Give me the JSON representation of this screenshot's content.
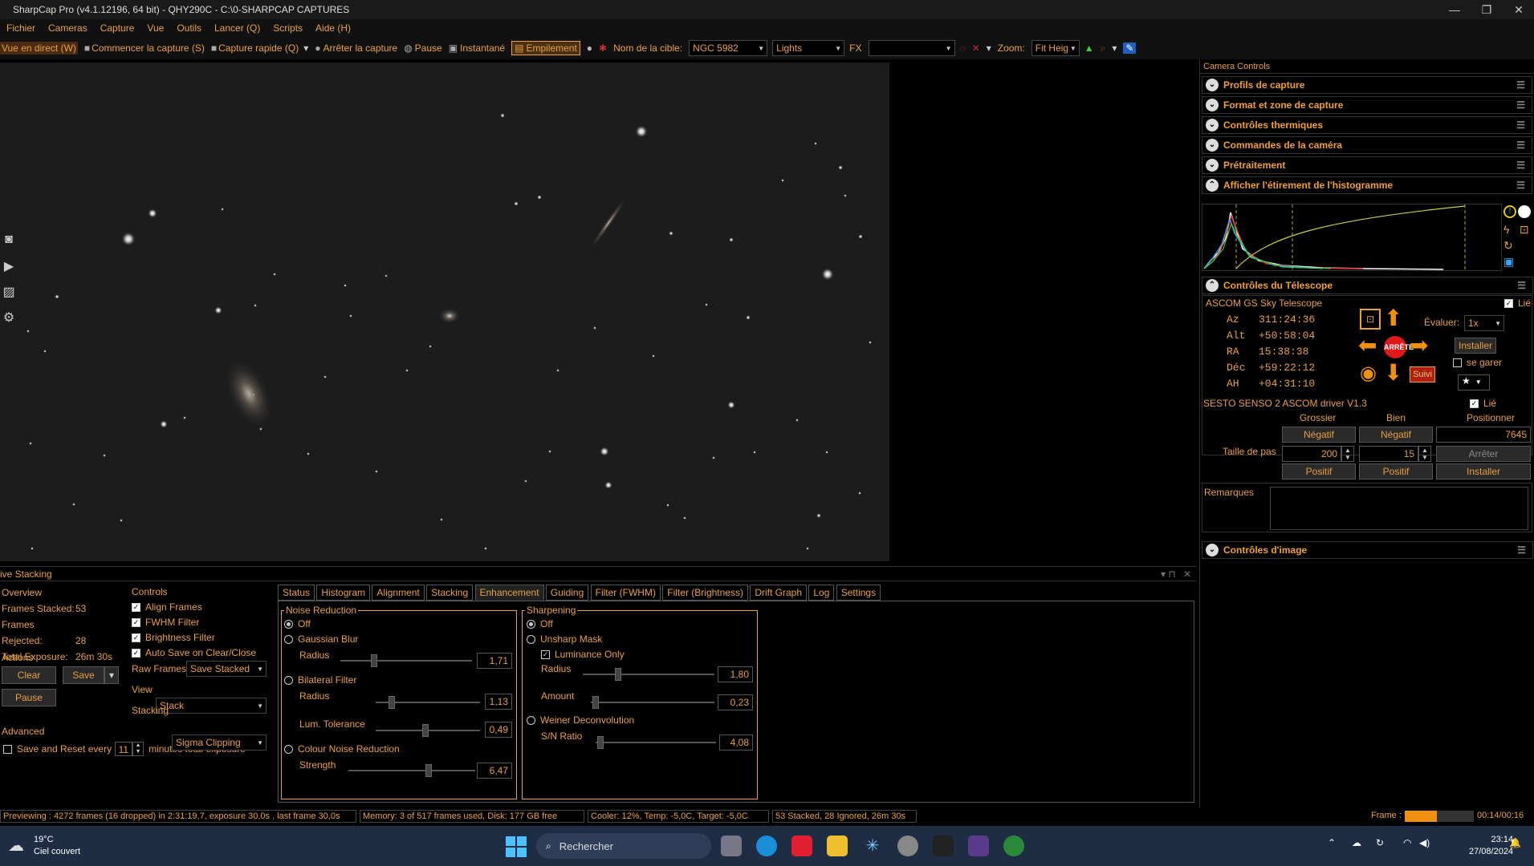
{
  "window": {
    "title": "SharpCap Pro (v4.1.12196, 64 bit) - QHY290C - C:\\0-SHARPCAP CAPTURES"
  },
  "menu": [
    "Fichier",
    "Cameras",
    "Capture",
    "Vue",
    "Outils",
    "Lancer (Q)",
    "Scripts",
    "Aide (H)"
  ],
  "toolbar": {
    "live_view": "Vue en direct (W)",
    "start_capture": "Commencer la capture (S)",
    "quick_capture": "Capture rapide (Q)",
    "stop_capture": "Arrêter la capture",
    "pause": "Pause",
    "snapshot": "Instantané",
    "stacking": "Empilement",
    "target_label": "Nom de la cible:",
    "target_value": "NGC 5982",
    "frame_type": "Lights",
    "fx_label": "FX",
    "zoom_label": "Zoom:",
    "zoom_value": "Fit Heig"
  },
  "camera_controls": {
    "title": "Camera Controls",
    "sections": [
      "Profils de capture",
      "Format et zone de capture",
      "Contrôles thermiques",
      "Commandes de la caméra",
      "Prétraitement"
    ],
    "histogram_title": "Afficher l'étirement de l'histogramme",
    "telescope": {
      "title": "Contrôles du Télescope",
      "name": "ASCOM GS Sky Telescope",
      "linked": "Lié",
      "az_label": "Az",
      "az": "311:24:36",
      "alt_label": "Alt",
      "alt": "+50:58:04",
      "ra_label": "RA",
      "ra": "15:38:38",
      "dec_label": "Déc",
      "dec": "+59:22:12",
      "ha_label": "AH",
      "ha": "+04:31:10",
      "stop": "ARRÊTE",
      "rate_label": "Évaluer:",
      "rate": "1x",
      "setup": "Installer",
      "park": "se garer",
      "track": "Suivi"
    },
    "focuser": {
      "name": "SESTO SENSO 2 ASCOM driver V1.3",
      "linked": "Lié",
      "coarse": "Grossier",
      "fine": "Bien",
      "position": "Positionner",
      "neg": "Négatif",
      "pos_btn": "Positif",
      "position_value": "7645",
      "step_label": "Taille de pas",
      "coarse_step": "200",
      "fine_step": "15",
      "stop": "Arrêter",
      "setup": "Installer"
    },
    "remarks_label": "Remarques",
    "image_controls": "Contrôles d'image"
  },
  "live_stacking": {
    "title": "ive Stacking",
    "overview": {
      "label": "Overview",
      "frames_stacked_label": "Frames Stacked:",
      "frames_stacked": "53",
      "frames_rejected_label": "Frames Rejected:",
      "frames_rejected": "28",
      "total_exposure_label": "Total Exposure:",
      "total_exposure": "26m 30s"
    },
    "actions": {
      "label": "Actions",
      "clear": "Clear",
      "save": "Save",
      "pause": "Pause"
    },
    "advanced": {
      "label": "Advanced",
      "save_reset": "Save and Reset every",
      "minutes": "11",
      "minutes_label": "minutes total exposure"
    },
    "controls": {
      "label": "Controls",
      "align": "Align Frames",
      "fwhm": "FWHM Filter",
      "brightness": "Brightness Filter",
      "autosave": "Auto Save on Clear/Close",
      "raw_label": "Raw Frames",
      "raw_value": "Save Stacked",
      "view_label": "View",
      "view_value": "Stack",
      "stacking_label": "Stacking",
      "stacking_value": "Sigma Clipping"
    },
    "tabs": [
      "Status",
      "Histogram",
      "Alignment",
      "Stacking",
      "Enhancement",
      "Guiding",
      "Filter (FWHM)",
      "Filter (Brightness)",
      "Drift Graph",
      "Log",
      "Settings"
    ],
    "noise": {
      "label": "Noise Reduction",
      "off": "Off",
      "gaussian": "Gaussian Blur",
      "radius": "Radius",
      "gauss_radius": "1,71",
      "bilateral": "Bilateral Filter",
      "bil_radius": "1,13",
      "lum_tol": "Lum. Tolerance",
      "lum_tol_val": "0,49",
      "colour": "Colour Noise Reduction",
      "strength": "Strength",
      "strength_val": "6,47"
    },
    "sharpening": {
      "label": "Sharpening",
      "off": "Off",
      "unsharp": "Unsharp Mask",
      "lum_only": "Luminance Only",
      "radius": "Radius",
      "radius_val": "1,80",
      "amount": "Amount",
      "amount_val": "0,23",
      "weiner": "Weiner Deconvolution",
      "sn": "S/N Ratio",
      "sn_val": "4,08"
    }
  },
  "status": {
    "preview": "Previewing : 4272 frames (16 dropped) in 2:31:19,7, exposure 30,0s , last frame 30,0s",
    "memory": "Memory: 3 of 517 frames used, Disk: 177 GB free",
    "cooler": "Cooler: 12%, Temp: -5,0C, Target: -5,0C",
    "stacked": "53 Stacked, 28 Ignored, 26m 30s",
    "frame_label": "Frame :",
    "frame_time": "00:14/00:16"
  },
  "taskbar": {
    "temp": "19°C",
    "weather": "Ciel couvert",
    "search": "Rechercher",
    "time": "23:14",
    "date": "27/08/2024"
  }
}
